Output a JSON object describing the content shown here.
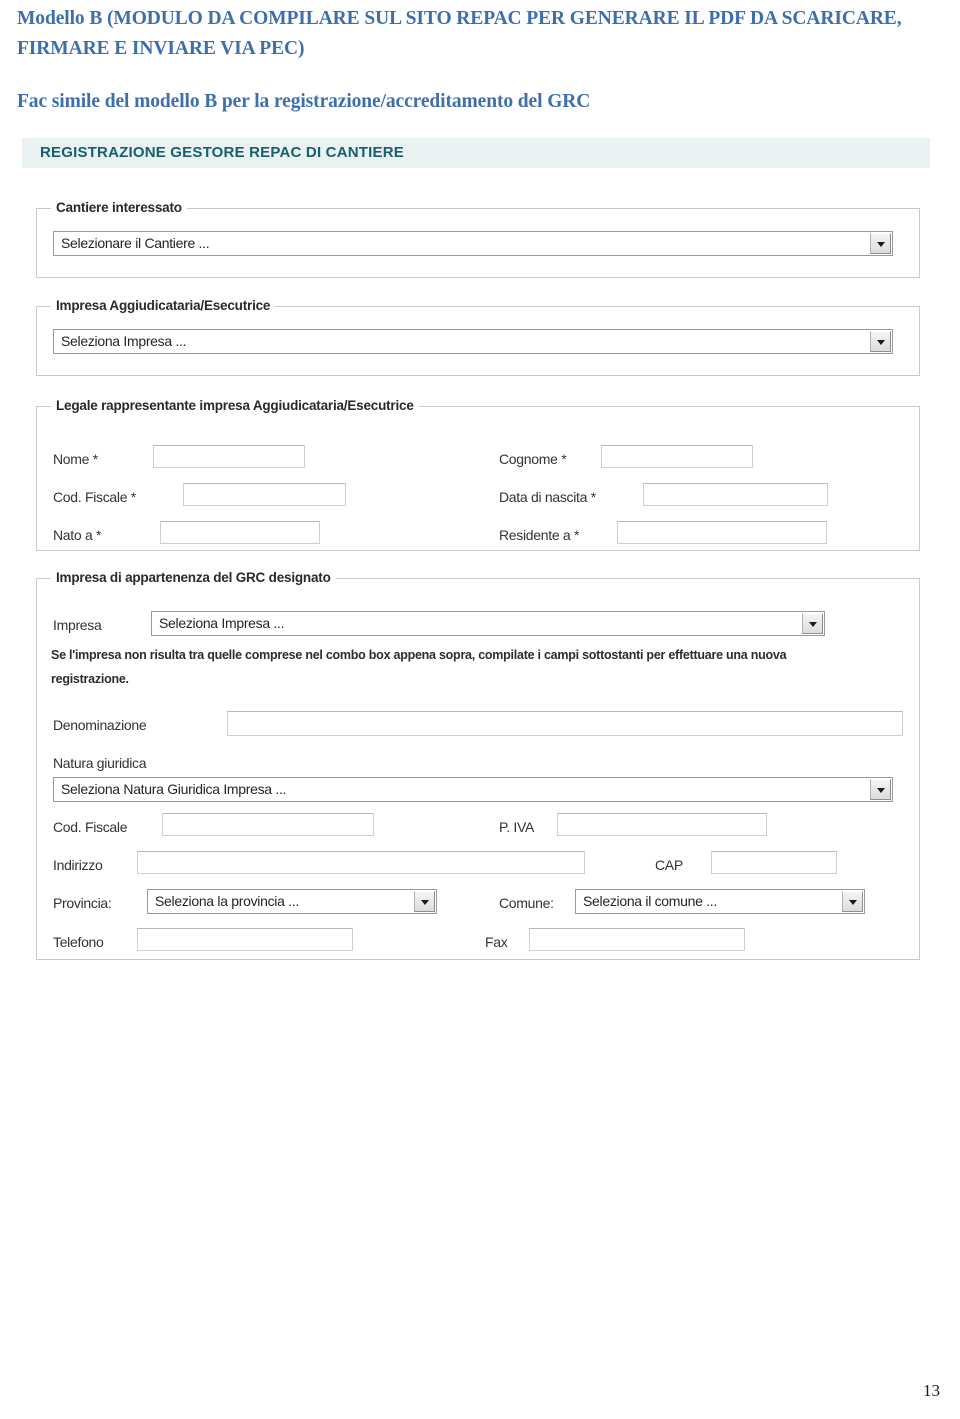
{
  "document": {
    "heading": "Modello B (MODULO DA COMPILARE SUL SITO REPAC PER GENERARE IL PDF DA SCARICARE, FIRMARE E INVIARE VIA PEC)",
    "subheading": "Fac simile del modello B per la registrazione/accreditamento del GRC",
    "page_number": "13"
  },
  "form": {
    "title": "REGISTRAZIONE GESTORE REPAC DI CANTIERE",
    "title_band_color": "#eaf1f2",
    "title_color": "#17606b",
    "heading_color": "#3f6fab",
    "sections": {
      "cantiere": {
        "legend": "Cantiere interessato",
        "select_value": "Selezionare il Cantiere ..."
      },
      "impresa_agg": {
        "legend": "Impresa Aggiudicataria/Esecutrice",
        "select_value": "Seleziona Impresa ..."
      },
      "legale": {
        "legend": "Legale rappresentante impresa Aggiudicataria/Esecutrice",
        "fields": {
          "nome": {
            "label": "Nome *",
            "value": ""
          },
          "cognome": {
            "label": "Cognome *",
            "value": ""
          },
          "cod_fiscale": {
            "label": "Cod. Fiscale *",
            "value": ""
          },
          "data_nascita": {
            "label": "Data di nascita *",
            "value": ""
          },
          "nato_a": {
            "label": "Nato a *",
            "value": ""
          },
          "residente_a": {
            "label": "Residente a *",
            "value": ""
          }
        }
      },
      "grc": {
        "legend": "Impresa di appartenenza del GRC designato",
        "impresa_label": "Impresa",
        "impresa_select_value": "Seleziona Impresa ...",
        "note": "Se l'impresa non risulta tra quelle comprese nel combo box appena sopra, compilate i campi sottostanti per effettuare una nuova registrazione.",
        "fields": {
          "denominazione": {
            "label": "Denominazione",
            "value": ""
          },
          "natura_giuridica": {
            "label": "Natura giuridica",
            "select_value": "Seleziona Natura Giuridica Impresa ..."
          },
          "cod_fiscale": {
            "label": "Cod. Fiscale",
            "value": ""
          },
          "p_iva": {
            "label": "P. IVA",
            "value": ""
          },
          "indirizzo": {
            "label": "Indirizzo",
            "value": ""
          },
          "cap": {
            "label": "CAP",
            "value": ""
          },
          "provincia": {
            "label": "Provincia:",
            "select_value": "Seleziona la provincia ..."
          },
          "comune": {
            "label": "Comune:",
            "select_value": "Seleziona il comune ..."
          },
          "telefono": {
            "label": "Telefono",
            "value": ""
          },
          "fax": {
            "label": "Fax",
            "value": ""
          }
        }
      }
    }
  }
}
